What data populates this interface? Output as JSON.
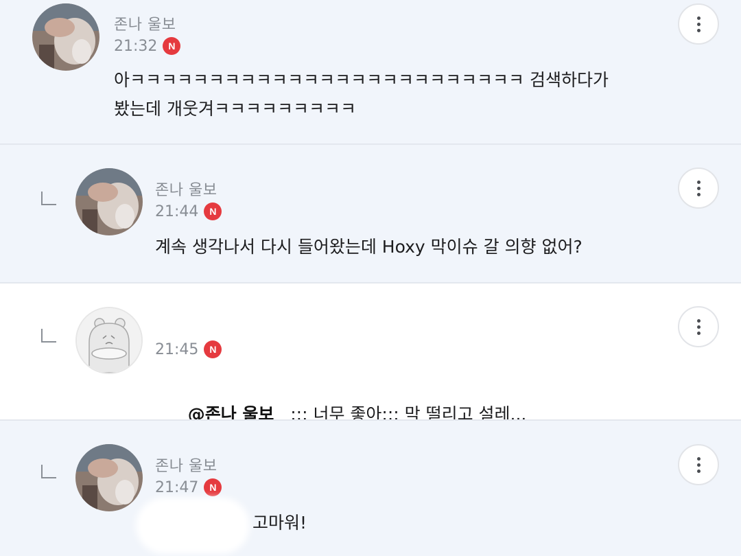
{
  "comments": [
    {
      "author": "존나 울보",
      "time": "21:32",
      "badge": "N",
      "text": "아ㅋㅋㅋㅋㅋㅋㅋㅋㅋㅋㅋㅋㅋㅋㅋㅋㅋㅋㅋㅋㅋㅋㅋㅋㅋ 검색하다가\n봤는데 개웃겨ㅋㅋㅋㅋㅋㅋㅋㅋㅋ",
      "is_reply": false,
      "highlighted": true,
      "avatar": "photo"
    },
    {
      "author": "존나 울보",
      "time": "21:44",
      "badge": "N",
      "text": "계속 생각나서 다시 들어왔는데 Hoxy 막이슈 갈 의향 없어?",
      "is_reply": true,
      "highlighted": true,
      "avatar": "photo"
    },
    {
      "author": "",
      "time": "21:45",
      "badge": "N",
      "mention": "@존나 울보",
      "text": ";;; 너무 좋아;;; 막 떨리고 설레...",
      "is_reply": true,
      "highlighted": false,
      "avatar": "default-character"
    },
    {
      "author": "존나 울보",
      "time": "21:47",
      "badge": "N",
      "text": "고마워!",
      "is_reply": true,
      "highlighted": true,
      "avatar": "photo"
    }
  ],
  "colors": {
    "highlight_bg": "#f1f5fb",
    "badge": "#e53a3f",
    "meta_text": "#888d94",
    "body_text": "#1c1c1e"
  }
}
